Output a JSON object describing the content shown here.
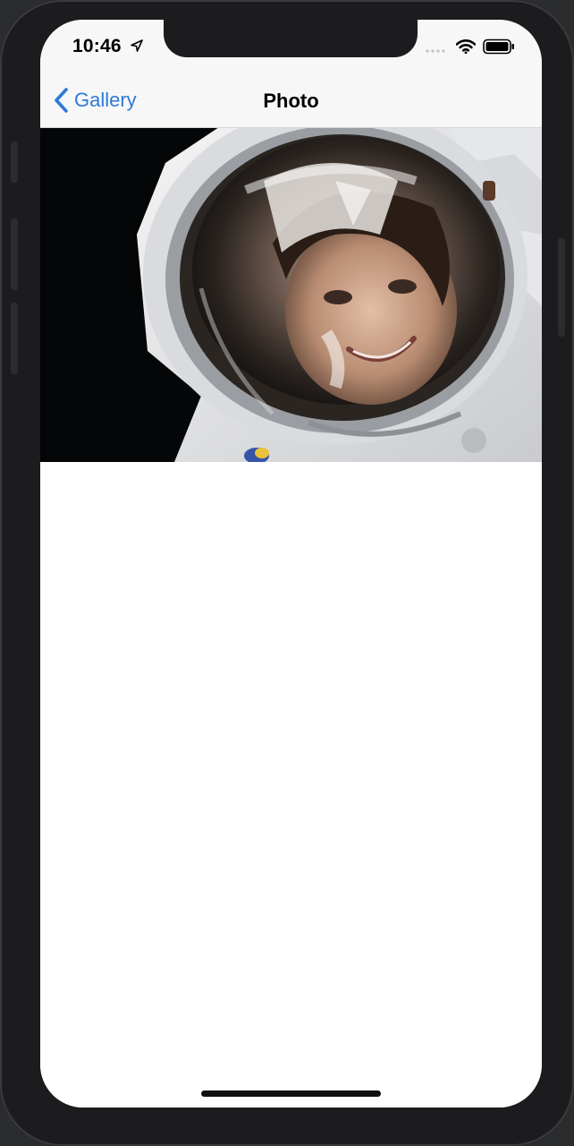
{
  "status_bar": {
    "time": "10:46",
    "location_icon": "location-arrow-icon",
    "signal_icon": "cellular-signal-icon",
    "wifi_icon": "wifi-icon",
    "battery_icon": "battery-icon"
  },
  "nav_bar": {
    "back_label": "Gallery",
    "back_icon": "chevron-left-icon",
    "title": "Photo"
  },
  "photo": {
    "alt": "Astronaut in spacesuit helmet taking a selfie in space"
  },
  "colors": {
    "accent": "#2f7ad6",
    "nav_background": "#f7f7f8",
    "frame": "#1c1c1e"
  }
}
